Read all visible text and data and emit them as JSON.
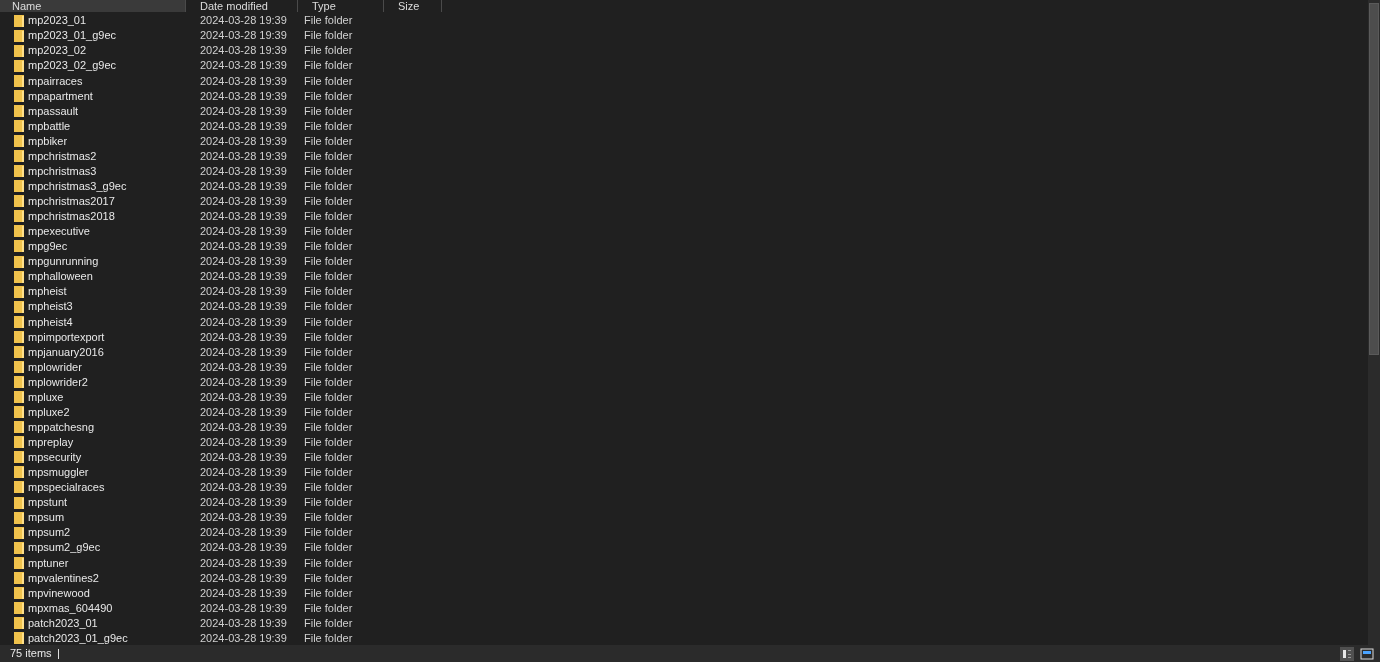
{
  "columns": [
    "Name",
    "Date modified",
    "Type",
    "Size"
  ],
  "rows": [
    {
      "name": "mp2023_01",
      "date": "2024-03-28 19:39",
      "type": "File folder"
    },
    {
      "name": "mp2023_01_g9ec",
      "date": "2024-03-28 19:39",
      "type": "File folder"
    },
    {
      "name": "mp2023_02",
      "date": "2024-03-28 19:39",
      "type": "File folder"
    },
    {
      "name": "mp2023_02_g9ec",
      "date": "2024-03-28 19:39",
      "type": "File folder"
    },
    {
      "name": "mpairraces",
      "date": "2024-03-28 19:39",
      "type": "File folder"
    },
    {
      "name": "mpapartment",
      "date": "2024-03-28 19:39",
      "type": "File folder"
    },
    {
      "name": "mpassault",
      "date": "2024-03-28 19:39",
      "type": "File folder"
    },
    {
      "name": "mpbattle",
      "date": "2024-03-28 19:39",
      "type": "File folder"
    },
    {
      "name": "mpbiker",
      "date": "2024-03-28 19:39",
      "type": "File folder"
    },
    {
      "name": "mpchristmas2",
      "date": "2024-03-28 19:39",
      "type": "File folder"
    },
    {
      "name": "mpchristmas3",
      "date": "2024-03-28 19:39",
      "type": "File folder"
    },
    {
      "name": "mpchristmas3_g9ec",
      "date": "2024-03-28 19:39",
      "type": "File folder"
    },
    {
      "name": "mpchristmas2017",
      "date": "2024-03-28 19:39",
      "type": "File folder"
    },
    {
      "name": "mpchristmas2018",
      "date": "2024-03-28 19:39",
      "type": "File folder"
    },
    {
      "name": "mpexecutive",
      "date": "2024-03-28 19:39",
      "type": "File folder"
    },
    {
      "name": "mpg9ec",
      "date": "2024-03-28 19:39",
      "type": "File folder"
    },
    {
      "name": "mpgunrunning",
      "date": "2024-03-28 19:39",
      "type": "File folder"
    },
    {
      "name": "mphalloween",
      "date": "2024-03-28 19:39",
      "type": "File folder"
    },
    {
      "name": "mpheist",
      "date": "2024-03-28 19:39",
      "type": "File folder"
    },
    {
      "name": "mpheist3",
      "date": "2024-03-28 19:39",
      "type": "File folder"
    },
    {
      "name": "mpheist4",
      "date": "2024-03-28 19:39",
      "type": "File folder"
    },
    {
      "name": "mpimportexport",
      "date": "2024-03-28 19:39",
      "type": "File folder"
    },
    {
      "name": "mpjanuary2016",
      "date": "2024-03-28 19:39",
      "type": "File folder"
    },
    {
      "name": "mplowrider",
      "date": "2024-03-28 19:39",
      "type": "File folder"
    },
    {
      "name": "mplowrider2",
      "date": "2024-03-28 19:39",
      "type": "File folder"
    },
    {
      "name": "mpluxe",
      "date": "2024-03-28 19:39",
      "type": "File folder"
    },
    {
      "name": "mpluxe2",
      "date": "2024-03-28 19:39",
      "type": "File folder"
    },
    {
      "name": "mppatchesng",
      "date": "2024-03-28 19:39",
      "type": "File folder"
    },
    {
      "name": "mpreplay",
      "date": "2024-03-28 19:39",
      "type": "File folder"
    },
    {
      "name": "mpsecurity",
      "date": "2024-03-28 19:39",
      "type": "File folder"
    },
    {
      "name": "mpsmuggler",
      "date": "2024-03-28 19:39",
      "type": "File folder"
    },
    {
      "name": "mpspecialraces",
      "date": "2024-03-28 19:39",
      "type": "File folder"
    },
    {
      "name": "mpstunt",
      "date": "2024-03-28 19:39",
      "type": "File folder"
    },
    {
      "name": "mpsum",
      "date": "2024-03-28 19:39",
      "type": "File folder"
    },
    {
      "name": "mpsum2",
      "date": "2024-03-28 19:39",
      "type": "File folder"
    },
    {
      "name": "mpsum2_g9ec",
      "date": "2024-03-28 19:39",
      "type": "File folder"
    },
    {
      "name": "mptuner",
      "date": "2024-03-28 19:39",
      "type": "File folder"
    },
    {
      "name": "mpvalentines2",
      "date": "2024-03-28 19:39",
      "type": "File folder"
    },
    {
      "name": "mpvinewood",
      "date": "2024-03-28 19:39",
      "type": "File folder"
    },
    {
      "name": "mpxmas_604490",
      "date": "2024-03-28 19:39",
      "type": "File folder"
    },
    {
      "name": "patch2023_01",
      "date": "2024-03-28 19:39",
      "type": "File folder"
    },
    {
      "name": "patch2023_01_g9ec",
      "date": "2024-03-28 19:39",
      "type": "File folder"
    }
  ],
  "status_bar": {
    "item_count": "75 items"
  }
}
